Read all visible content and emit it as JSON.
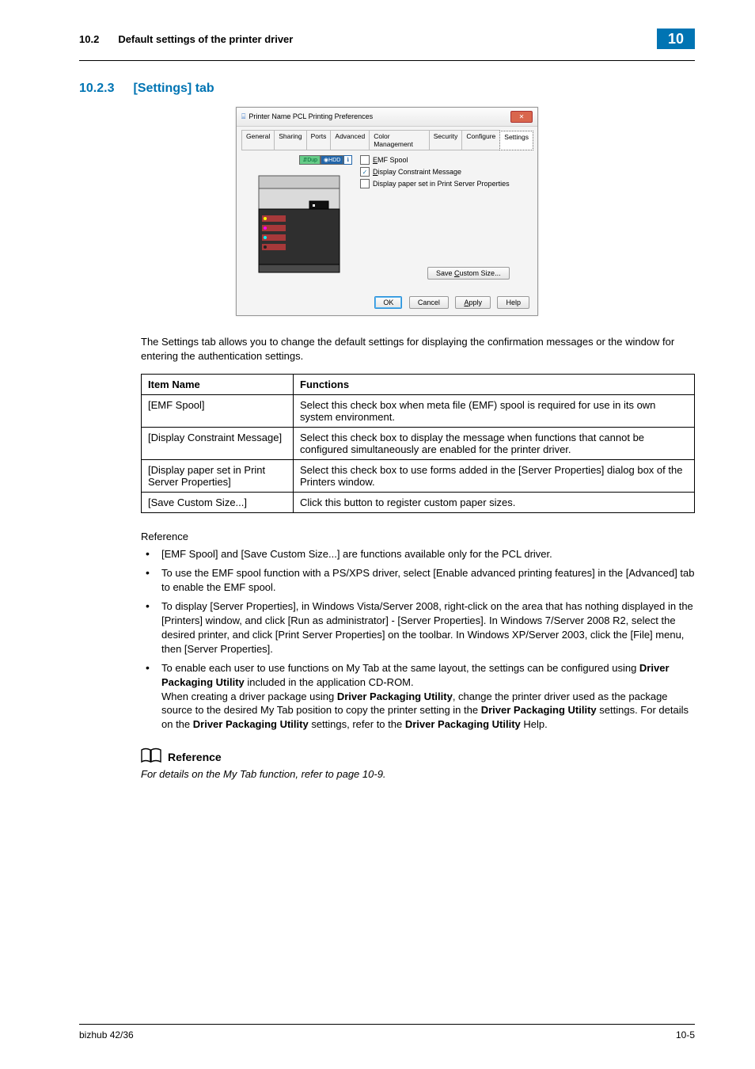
{
  "header": {
    "section_no": "10.2",
    "section_title": "Default settings of the printer driver",
    "chapter_badge": "10"
  },
  "section": {
    "number": "10.2.3",
    "title": "[Settings] tab"
  },
  "dialog": {
    "title": "Printer Name PCL Printing Preferences",
    "tabs": [
      "General",
      "Sharing",
      "Ports",
      "Advanced",
      "Color Management",
      "Security",
      "Configure",
      "Settings"
    ],
    "checks": {
      "emf": "EMF Spool",
      "disp_constraint": "Display Constraint Message",
      "disp_paper": "Display paper set in Print Server Properties"
    },
    "save_custom": "Save Custom Size...",
    "btn_ok": "OK",
    "btn_cancel": "Cancel",
    "btn_apply": "Apply",
    "btn_help": "Help"
  },
  "intro_text": "The Settings tab allows you to change the default settings for displaying the confirmation messages or the window for entering the authentication settings.",
  "table": {
    "h_item": "Item Name",
    "h_func": "Functions",
    "rows": [
      {
        "item": "[EMF Spool]",
        "func": "Select this check box when meta file (EMF) spool is required for use in its own system environment."
      },
      {
        "item": "[Display Constraint Message]",
        "func": "Select this check box to display the message when functions that cannot be configured simultaneously are enabled for the printer driver."
      },
      {
        "item": "[Display paper set in Print Server Properties]",
        "func": "Select this check box to use forms added in the [Server Properties] dialog box of the Printers window."
      },
      {
        "item": "[Save Custom Size...]",
        "func": "Click this button to register custom paper sizes."
      }
    ]
  },
  "reference_label": "Reference",
  "bullets": {
    "b1": "[EMF Spool] and [Save Custom Size...] are functions available only for the PCL driver.",
    "b2": "To use the EMF spool function with a PS/XPS driver, select [Enable advanced printing features] in the [Advanced] tab to enable the EMF spool.",
    "b3": "To display [Server Properties], in Windows Vista/Server 2008, right-click on the area that has nothing displayed in the [Printers] window, and click [Run as administrator] - [Server Properties]. In Windows 7/Server 2008 R2, select the desired printer, and click [Print Server Properties] on the toolbar. In Windows XP/Server 2003, click the [File] menu, then [Server Properties].",
    "b4_pre": "To enable each user to use functions on My Tab at the same layout, the settings can be configured using ",
    "b4_dpu": "Driver Packaging Utility",
    "b4_mid1": " included in the application CD-ROM.",
    "b4_line2a": "When creating a driver package using ",
    "b4_line2b": ", change the printer driver used as the package source to the desired My Tab position to copy the printer setting in the ",
    "b4_dpu2": "Driver Packaging Utility",
    "b4_line2c": " settings. For details on the ",
    "b4_line2d": " settings, refer to the ",
    "b4_line2e": " Help."
  },
  "ref2_heading": "Reference",
  "ref2_text": "For details on the My Tab function, refer to page 10-9.",
  "footer": {
    "left": "bizhub 42/36",
    "right": "10-5"
  }
}
